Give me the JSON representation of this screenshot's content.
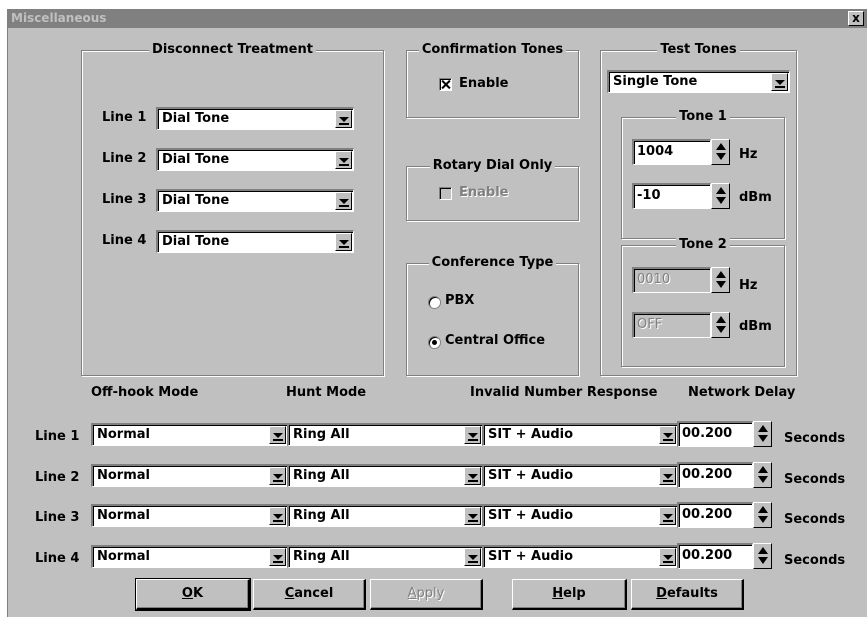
{
  "window": {
    "title": "Miscellaneous",
    "close_glyph": "x"
  },
  "disconnect": {
    "title": "Disconnect Treatment",
    "lines": [
      {
        "label": "Line 1",
        "value": "Dial Tone"
      },
      {
        "label": "Line 2",
        "value": "Dial Tone"
      },
      {
        "label": "Line 3",
        "value": "Dial Tone"
      },
      {
        "label": "Line 4",
        "value": "Dial Tone"
      }
    ]
  },
  "confirmation": {
    "title": "Confirmation Tones",
    "enable_label": "Enable",
    "checked": true
  },
  "rotary": {
    "title": "Rotary Dial Only",
    "enable_label": "Enable",
    "checked": false
  },
  "conference": {
    "title": "Conference Type",
    "options": [
      "PBX",
      "Central Office"
    ],
    "selected": "Central Office"
  },
  "test_tones": {
    "title": "Test Tones",
    "mode": "Single Tone",
    "tone1": {
      "title": "Tone 1",
      "freq": "1004",
      "freq_unit": "Hz",
      "level": "-10",
      "level_unit": "dBm"
    },
    "tone2": {
      "title": "Tone 2",
      "freq": "0010",
      "freq_unit": "Hz",
      "level": "OFF",
      "level_unit": "dBm"
    }
  },
  "columns": {
    "offhook": "Off-hook Mode",
    "hunt": "Hunt Mode",
    "invalid": "Invalid Number Response",
    "delay": "Network Delay"
  },
  "rows": [
    {
      "label": "Line 1",
      "offhook": "Normal",
      "hunt": "Ring All",
      "invalid": "SIT + Audio",
      "delay": "00.200",
      "unit": "Seconds"
    },
    {
      "label": "Line 2",
      "offhook": "Normal",
      "hunt": "Ring All",
      "invalid": "SIT + Audio",
      "delay": "00.200",
      "unit": "Seconds"
    },
    {
      "label": "Line 3",
      "offhook": "Normal",
      "hunt": "Ring All",
      "invalid": "SIT + Audio",
      "delay": "00.200",
      "unit": "Seconds"
    },
    {
      "label": "Line 4",
      "offhook": "Normal",
      "hunt": "Ring All",
      "invalid": "SIT + Audio",
      "delay": "00.200",
      "unit": "Seconds"
    }
  ],
  "buttons": {
    "ok": {
      "accel": "O",
      "rest": "K"
    },
    "cancel": {
      "accel": "C",
      "rest": "ancel"
    },
    "apply": {
      "accel": "A",
      "rest": "pply"
    },
    "help": {
      "accel": "H",
      "rest": "elp"
    },
    "defaults": {
      "accel": "D",
      "rest": "efaults"
    }
  }
}
